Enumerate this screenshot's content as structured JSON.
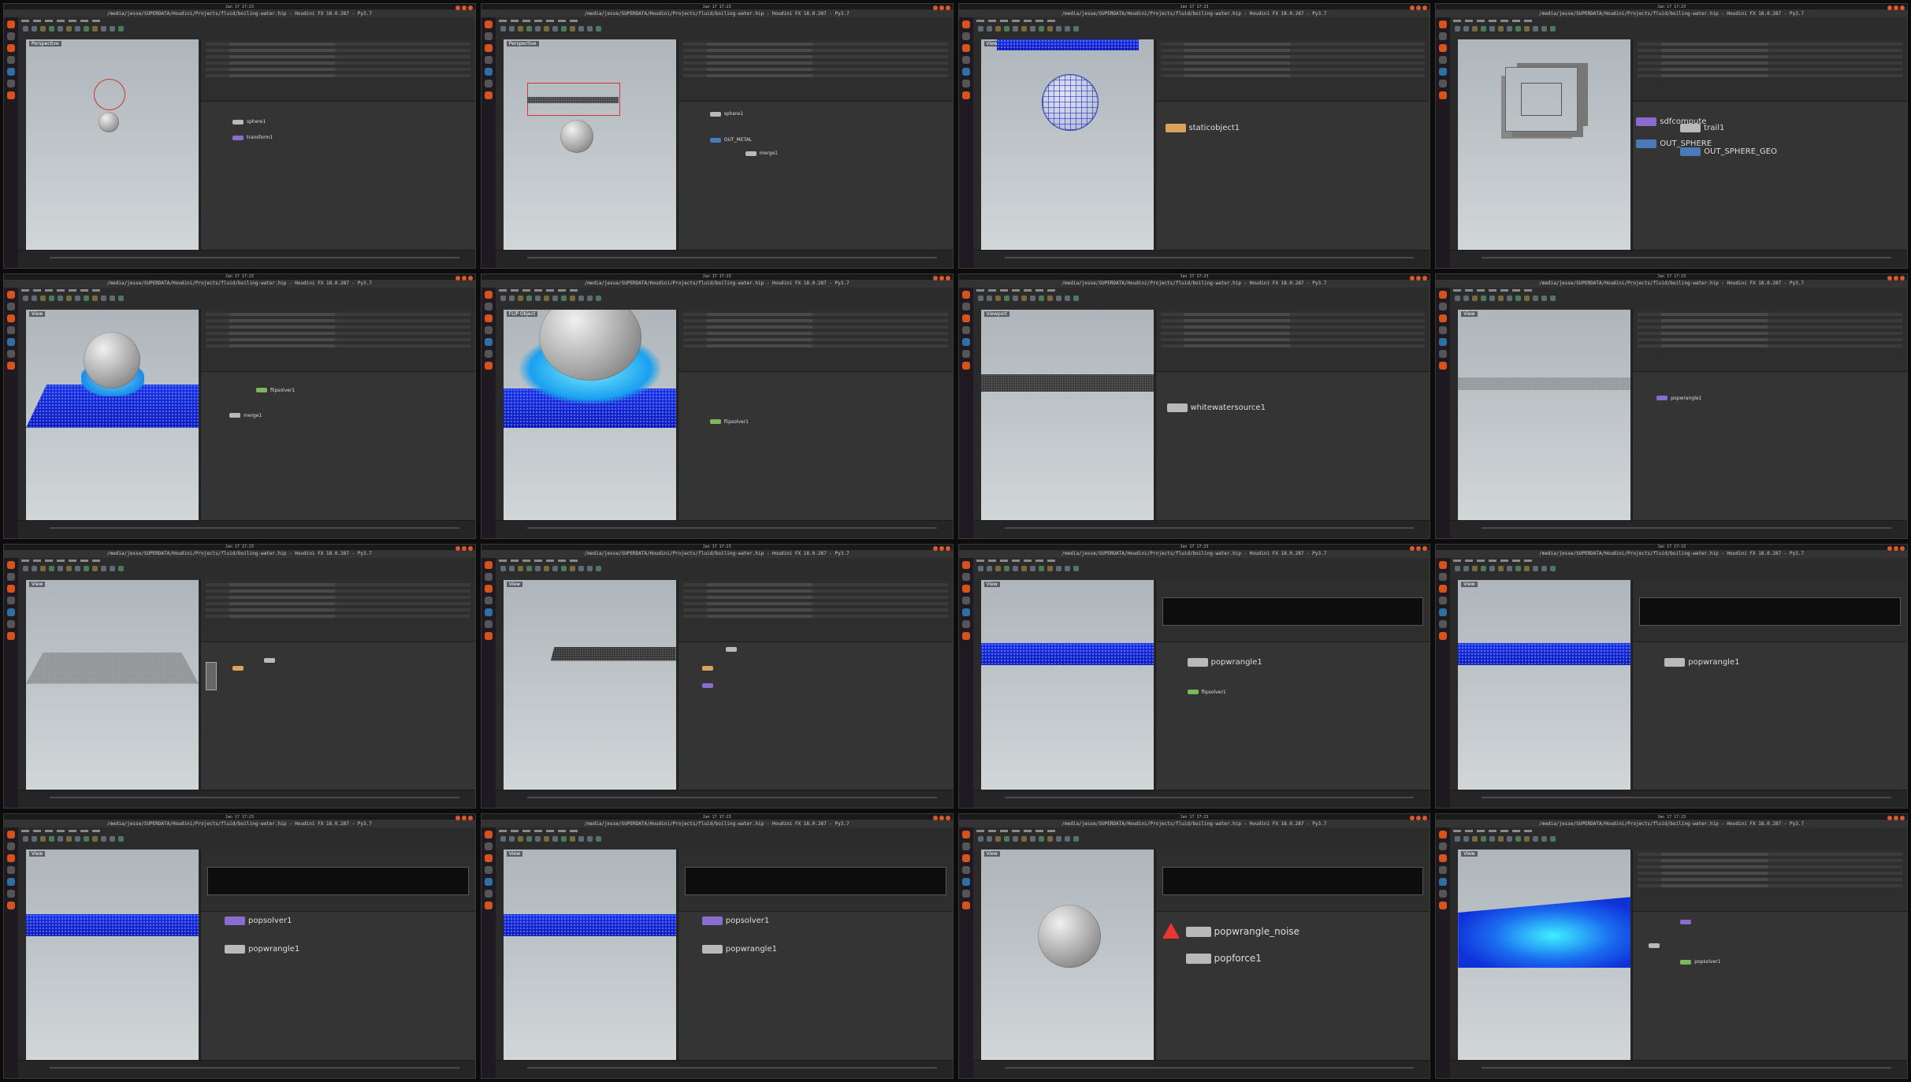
{
  "window_title": "/media/jesse/SUPERDATA/Houdini/Projects/fluid/boiling-water.hip - Houdini FX 18.0.287 - Py3.7",
  "clock": "Jan 17 17:23",
  "tiles": [
    {
      "id": 1,
      "viewport_label": "Perspective",
      "nodes": [
        {
          "label": "sphere1",
          "size": "small"
        },
        {
          "label": "transform1",
          "size": "small"
        }
      ]
    },
    {
      "id": 2,
      "viewport_label": "Perspective",
      "nodes": [
        {
          "label": "sphere1",
          "size": "small"
        },
        {
          "label": "OUT_METAL",
          "size": "small"
        },
        {
          "label": "merge1",
          "size": "small"
        }
      ]
    },
    {
      "id": 3,
      "viewport_label": "View",
      "nodes": [
        {
          "label": "staticobject1",
          "size": "big"
        }
      ]
    },
    {
      "id": 4,
      "viewport_label": "",
      "nodes": [
        {
          "label": "sdfcompute",
          "size": "big"
        },
        {
          "label": "trail1",
          "size": "big"
        },
        {
          "label": "OUT_SPHERE",
          "size": "big"
        },
        {
          "label": "OUT_SPHERE_GEO",
          "size": "big"
        }
      ]
    },
    {
      "id": 5,
      "viewport_label": "View",
      "nodes": [
        {
          "label": "flipsolver1",
          "size": "small"
        },
        {
          "label": "merge1",
          "size": "small"
        }
      ]
    },
    {
      "id": 6,
      "viewport_label": "FLIP Object",
      "nodes": [
        {
          "label": "flipsolver1",
          "size": "small"
        }
      ]
    },
    {
      "id": 7,
      "viewport_label": "Viewport",
      "nodes": [
        {
          "label": "whitewatersource1",
          "size": "big"
        }
      ]
    },
    {
      "id": 8,
      "viewport_label": "View",
      "nodes": [
        {
          "label": "popwrangle1",
          "size": "small"
        }
      ]
    },
    {
      "id": 9,
      "viewport_label": "View",
      "nodes": []
    },
    {
      "id": 10,
      "viewport_label": "View",
      "nodes": []
    },
    {
      "id": 11,
      "viewport_label": "View",
      "nodes": [
        {
          "label": "popwrangle1",
          "size": "big"
        },
        {
          "label": "flipsolver1",
          "size": "small"
        }
      ]
    },
    {
      "id": 12,
      "viewport_label": "View",
      "nodes": [
        {
          "label": "popwrangle1",
          "size": "big"
        }
      ]
    },
    {
      "id": 13,
      "viewport_label": "View",
      "nodes": [
        {
          "label": "popsolver1",
          "size": "big"
        },
        {
          "label": "popwrangle1",
          "size": "big"
        }
      ]
    },
    {
      "id": 14,
      "viewport_label": "View",
      "nodes": [
        {
          "label": "popsolver1",
          "size": "big"
        },
        {
          "label": "popwrangle1",
          "size": "big"
        }
      ]
    },
    {
      "id": 15,
      "viewport_label": "View",
      "nodes": [
        {
          "label": "popwrangle_noise",
          "size": "xl"
        },
        {
          "label": "popforce1",
          "size": "xl"
        }
      ]
    },
    {
      "id": 16,
      "viewport_label": "View",
      "nodes": [
        {
          "label": "popsolver1",
          "size": "small"
        }
      ]
    }
  ]
}
